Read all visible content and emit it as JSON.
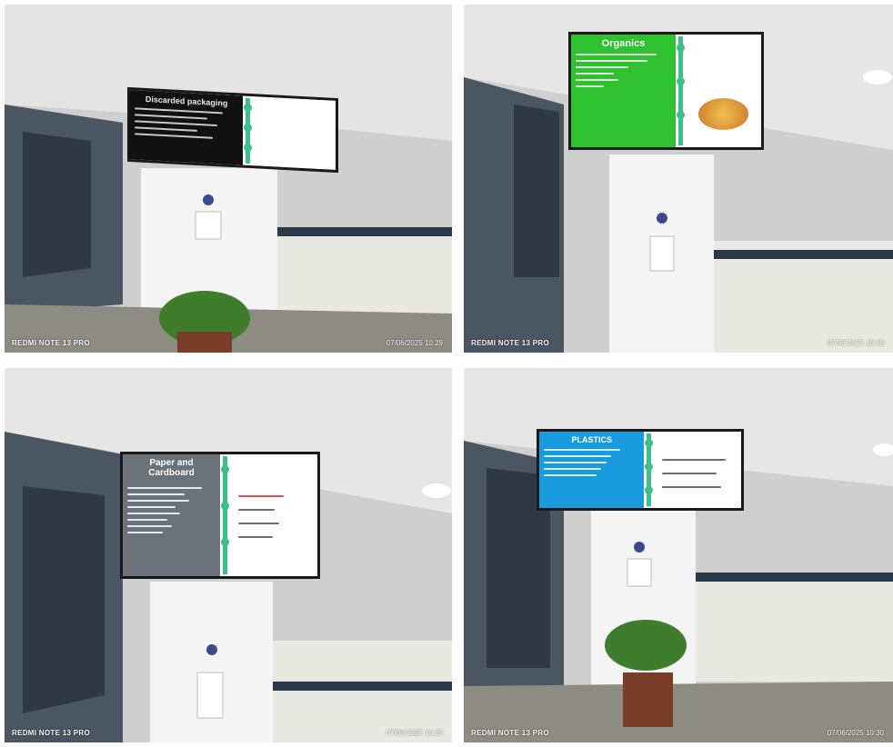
{
  "photos": [
    {
      "id": "top-left",
      "screen_heading": "Discarded packaging",
      "screen_bg": "#111111",
      "screen_text_color": "#e8e8e8",
      "watermark": "REDMI NOTE 13 PRO",
      "timestamp": "07/06/2025 10:29"
    },
    {
      "id": "top-right",
      "screen_heading": "Organics",
      "screen_bg": "#2fc12f",
      "screen_text_color": "#ffffff",
      "watermark": "REDMI NOTE 13 PRO",
      "timestamp": "07/06/2025 10:29"
    },
    {
      "id": "bottom-left",
      "screen_heading": "Paper and Cardboard",
      "screen_bg": "#6b7278",
      "screen_text_color": "#ffffff",
      "watermark": "REDMI NOTE 13 PRO",
      "timestamp": "07/06/2025 10:29"
    },
    {
      "id": "bottom-right",
      "screen_heading": "PLASTICS",
      "screen_bg": "#1a9be0",
      "screen_text_color": "#ffffff",
      "watermark": "REDMI NOTE 13 PRO",
      "timestamp": "07/06/2025 10:30"
    }
  ],
  "colors": {
    "wall": "#d8d8d8",
    "ceiling": "#e6e6e6",
    "pillar": "#f3f3f3",
    "floor": "#8c8c82",
    "counter": "#2a3a4a",
    "plant": "#3f7d2c",
    "pot": "#7a3d2a"
  }
}
